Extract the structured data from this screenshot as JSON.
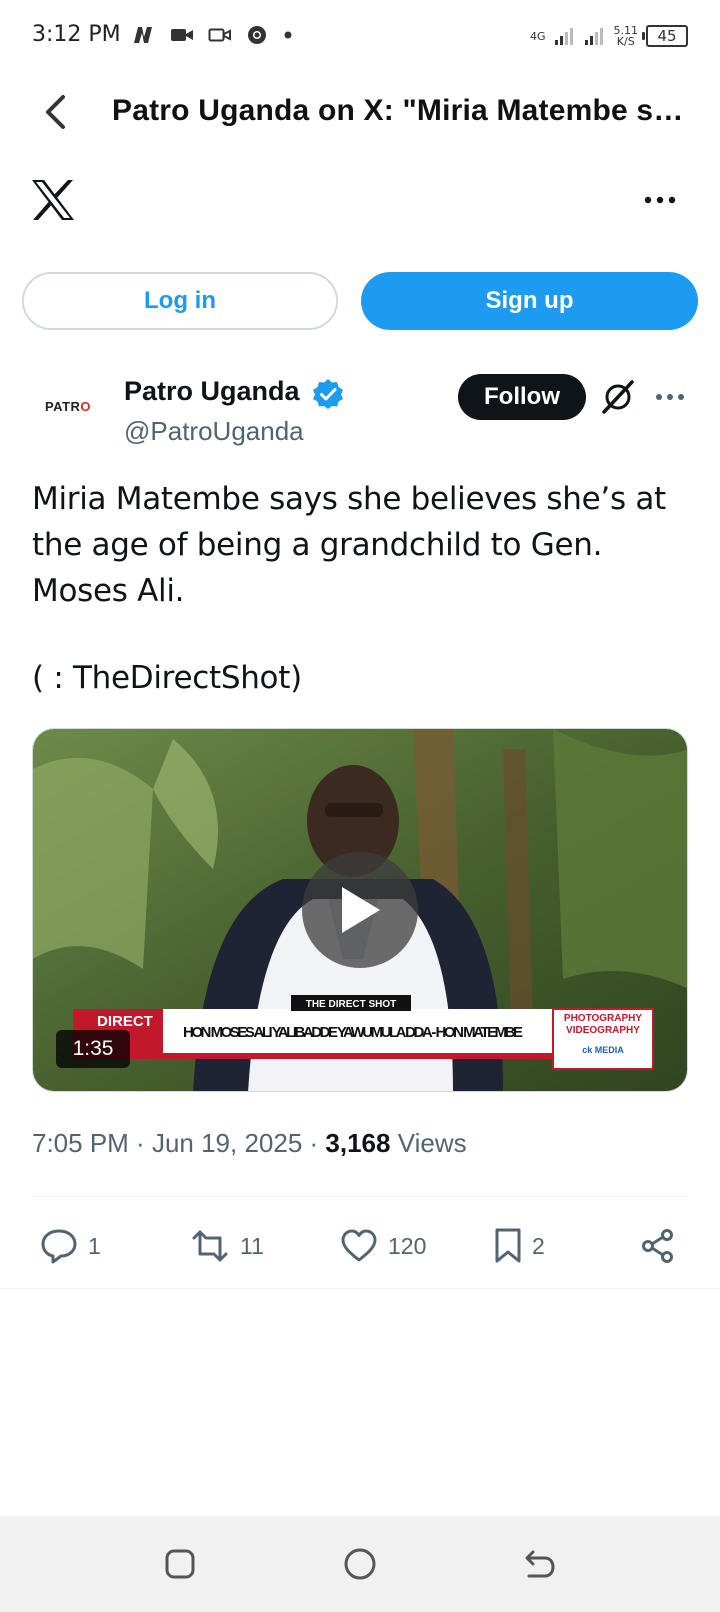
{
  "status_bar": {
    "time": "3:12 PM",
    "network": "4G",
    "speed_value": "5.11",
    "speed_unit": "K/S",
    "battery": "45"
  },
  "title_bar": {
    "title": "Patro Uganda on X: \"Miria Matembe says she believes she’s at the age of being a grandchild to Gen. Moses Ali."
  },
  "auth": {
    "login_label": "Log in",
    "signup_label": "Sign up"
  },
  "tweet": {
    "avatar_text_left": "PATR",
    "avatar_text_right": "O",
    "author_name": "Patro Uganda",
    "author_handle": "@PatroUganda",
    "follow_label": "Follow",
    "text": "Miria Matembe says she believes she’s at the age of being a grandchild to Gen. Moses Ali.",
    "credit": "(      : TheDirectShot)",
    "video": {
      "duration": "1:35",
      "banner_brand": "DIRECT",
      "banner_headline": "HON MOSES ALI YALIBADDE YAWUMULA DDA - HON MATEMBE",
      "banner_tag": "THE DIRECT SHOT",
      "banner_side_1": "PHOTOGRAPHY",
      "banner_side_2": "VIDEOGRAPHY",
      "banner_side_3": "ck MEDIA"
    },
    "time": "7:05 PM",
    "date": "Jun 19, 2025",
    "views_count": "3,168",
    "views_label": "Views",
    "replies": "1",
    "reposts": "11",
    "likes": "120",
    "bookmarks": "2"
  },
  "colors": {
    "accent": "#1d9bf0",
    "text": "#0f1419",
    "muted": "#536471"
  }
}
